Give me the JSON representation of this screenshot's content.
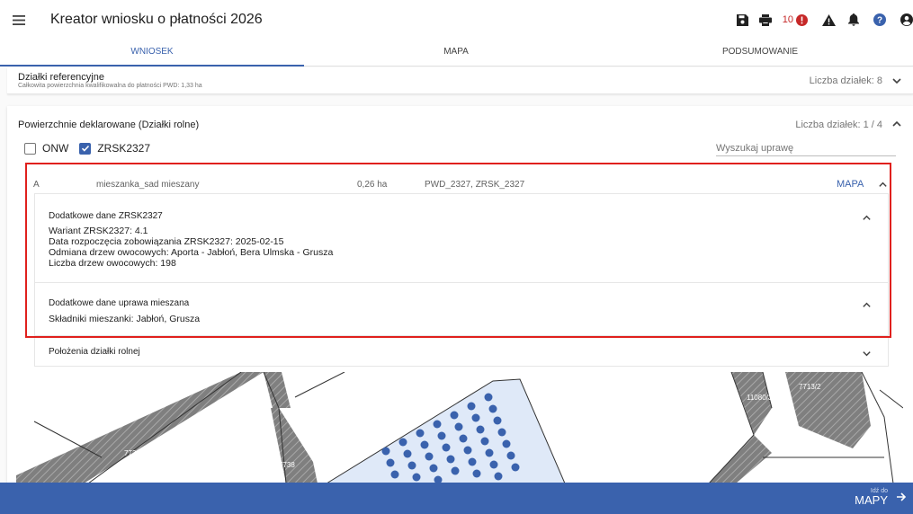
{
  "header": {
    "title": "Kreator wniosku o płatności 2026",
    "error_count": "10"
  },
  "tabs": [
    {
      "label": "WNIOSEK",
      "active": true
    },
    {
      "label": "MAPA",
      "active": false
    },
    {
      "label": "PODSUMOWANIE",
      "active": false
    }
  ],
  "reference": {
    "title": "Działki referencyjne",
    "subtitle": "Całkowita powierzchnia kwalifikowalna do płatności PWD: 1,33 ha",
    "count": "Liczba działek: 8"
  },
  "declared": {
    "title": "Powierzchnie deklarowane (Działki rolne)",
    "count": "Liczba działek: 1 / 4",
    "filters": [
      {
        "label": "ONW",
        "checked": false
      },
      {
        "label": "ZRSK2327",
        "checked": true
      }
    ],
    "search_placeholder": "Wyszukaj uprawę"
  },
  "parcel_row": {
    "letter": "A",
    "crop": "mieszanka_sad mieszany",
    "area": "0,26 ha",
    "interventions": "PWD_2327, ZRSK_2327",
    "map_link": "MAPA"
  },
  "extra_zrsk": {
    "title": "Dodatkowe dane ZRSK2327",
    "lines": [
      "Wariant ZRSK2327: 4.1",
      "Data rozpoczęcia zobowiązania ZRSK2327: 2025-02-15",
      "Odmiana drzew owocowych: Aporta - Jabłoń, Bera Ulmska - Grusza",
      "Liczba drzew owocowych: 198"
    ]
  },
  "extra_mix": {
    "title": "Dodatkowe dane uprawa mieszana",
    "lines": [
      "Składniki mieszanki: Jabłoń, Grusza"
    ]
  },
  "location": {
    "title": "Położenia działki rolnej"
  },
  "map": {
    "labels": [
      "7739/2",
      "7738",
      "11080/3",
      "7713/2"
    ]
  },
  "footer": {
    "goto_small": "Idź do",
    "goto_big": "MAPY"
  },
  "colors": {
    "accent": "#3a62ad",
    "highlight": "#e0201d",
    "error": "#c62828",
    "parcel_fill": "#dfe9f8",
    "tree_marker": "#3a62ad"
  }
}
